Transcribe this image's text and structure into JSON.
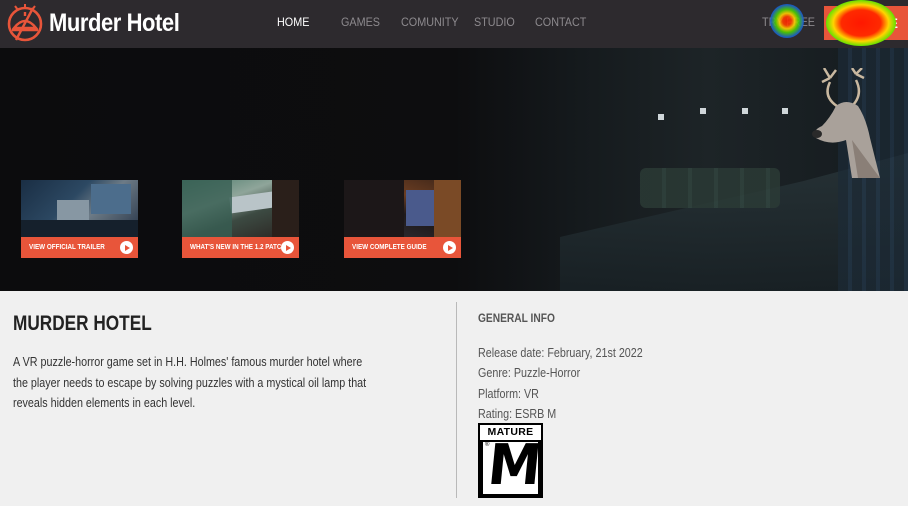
{
  "header": {
    "brand": "Murder Hotel",
    "nav": [
      {
        "label": "HOME",
        "active": true
      },
      {
        "label": "GAMES",
        "active": false
      },
      {
        "label": "COMUNITY",
        "active": false
      },
      {
        "label": "STUDIO",
        "active": false
      },
      {
        "label": "CONTACT",
        "active": false
      }
    ],
    "try_free": "TRY FREE",
    "cta_label": "ME"
  },
  "hero": {
    "thumbnails": [
      {
        "label": "VIEW OFFICIAL TRAILER",
        "icon": "play-icon"
      },
      {
        "label": "WHAT'S NEW IN THE 1.2 PATCH",
        "icon": "play-icon"
      },
      {
        "label": "VIEW COMPLETE GUIDE",
        "icon": "play-icon"
      }
    ]
  },
  "game": {
    "title": "MURDER HOTEL",
    "description": "A VR puzzle-horror game set in H.H. Holmes' famous murder hotel where the player needs to escape by solving puzzles with a mystical oil lamp that reveals hidden elements in each level."
  },
  "info": {
    "heading": "GENERAL INFO",
    "rows": [
      "Release date: February, 21st 2022",
      "Genre: Puzzle-Horror",
      "Platform: VR",
      "Rating: ESRB M"
    ],
    "rating_badge": {
      "top": "MATURE",
      "letter": "M",
      "reg": "®"
    }
  },
  "colors": {
    "accent": "#e8553a",
    "nav_bg": "#2d2a2e",
    "content_bg": "#f0f0f0"
  }
}
